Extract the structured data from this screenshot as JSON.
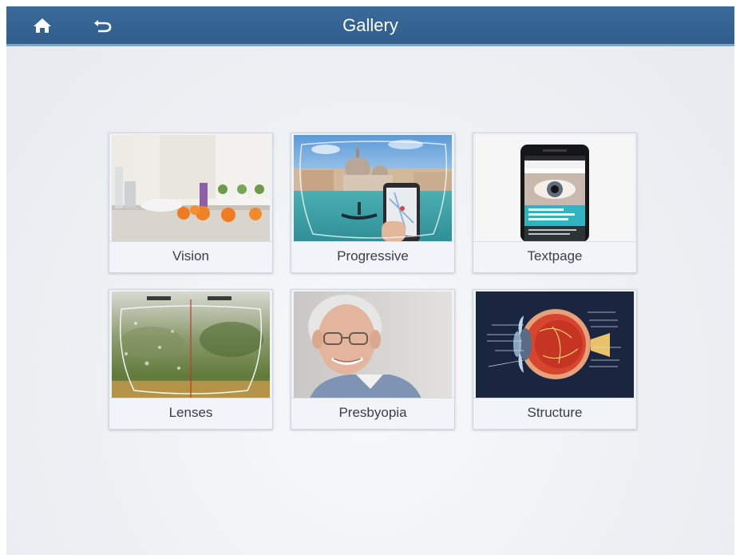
{
  "header": {
    "title": "Gallery",
    "home_icon": "home-icon",
    "back_icon": "undo-arrow-icon",
    "bar_color": "#3a6a98"
  },
  "gallery": {
    "items": [
      {
        "label": "Vision",
        "image": "kitchen-oranges-photo"
      },
      {
        "label": "Progressive",
        "image": "venice-lens-phone-photo"
      },
      {
        "label": "Textpage",
        "image": "smartphone-eye-article-photo"
      },
      {
        "label": "Lenses",
        "image": "lens-comparison-photo"
      },
      {
        "label": "Presbyopia",
        "image": "elderly-man-glasses-photo"
      },
      {
        "label": "Structure",
        "image": "eye-anatomy-diagram"
      }
    ]
  }
}
